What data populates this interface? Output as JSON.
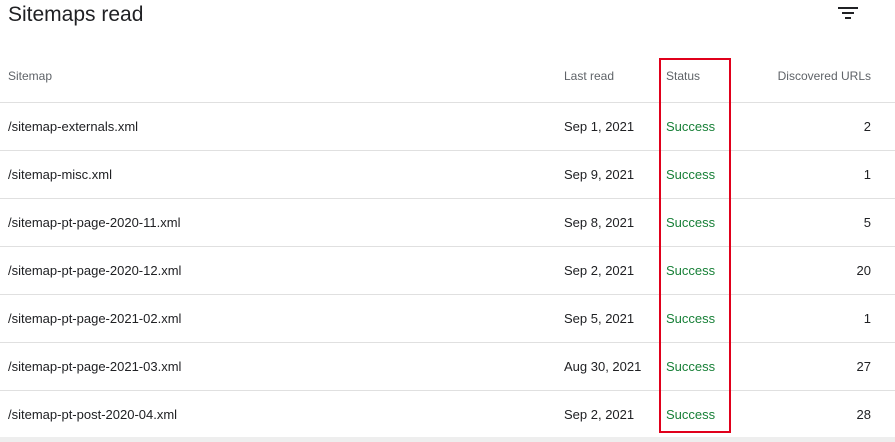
{
  "header": {
    "title": "Sitemaps read",
    "filter_icon": "filter-icon"
  },
  "table": {
    "columns": {
      "sitemap": "Sitemap",
      "last_read": "Last read",
      "status": "Status",
      "discovered_urls": "Discovered URLs"
    },
    "rows": [
      {
        "sitemap": "/sitemap-externals.xml",
        "last_read": "Sep 1, 2021",
        "status": "Success",
        "discovered_urls": "2"
      },
      {
        "sitemap": "/sitemap-misc.xml",
        "last_read": "Sep 9, 2021",
        "status": "Success",
        "discovered_urls": "1"
      },
      {
        "sitemap": "/sitemap-pt-page-2020-11.xml",
        "last_read": "Sep 8, 2021",
        "status": "Success",
        "discovered_urls": "5"
      },
      {
        "sitemap": "/sitemap-pt-page-2020-12.xml",
        "last_read": "Sep 2, 2021",
        "status": "Success",
        "discovered_urls": "20"
      },
      {
        "sitemap": "/sitemap-pt-page-2021-02.xml",
        "last_read": "Sep 5, 2021",
        "status": "Success",
        "discovered_urls": "1"
      },
      {
        "sitemap": "/sitemap-pt-page-2021-03.xml",
        "last_read": "Aug 30, 2021",
        "status": "Success",
        "discovered_urls": "27"
      },
      {
        "sitemap": "/sitemap-pt-post-2020-04.xml",
        "last_read": "Sep 2, 2021",
        "status": "Success",
        "discovered_urls": "28"
      }
    ]
  },
  "colors": {
    "success": "#188038",
    "highlight": "#e0001b",
    "divider": "#e0e0e0"
  }
}
